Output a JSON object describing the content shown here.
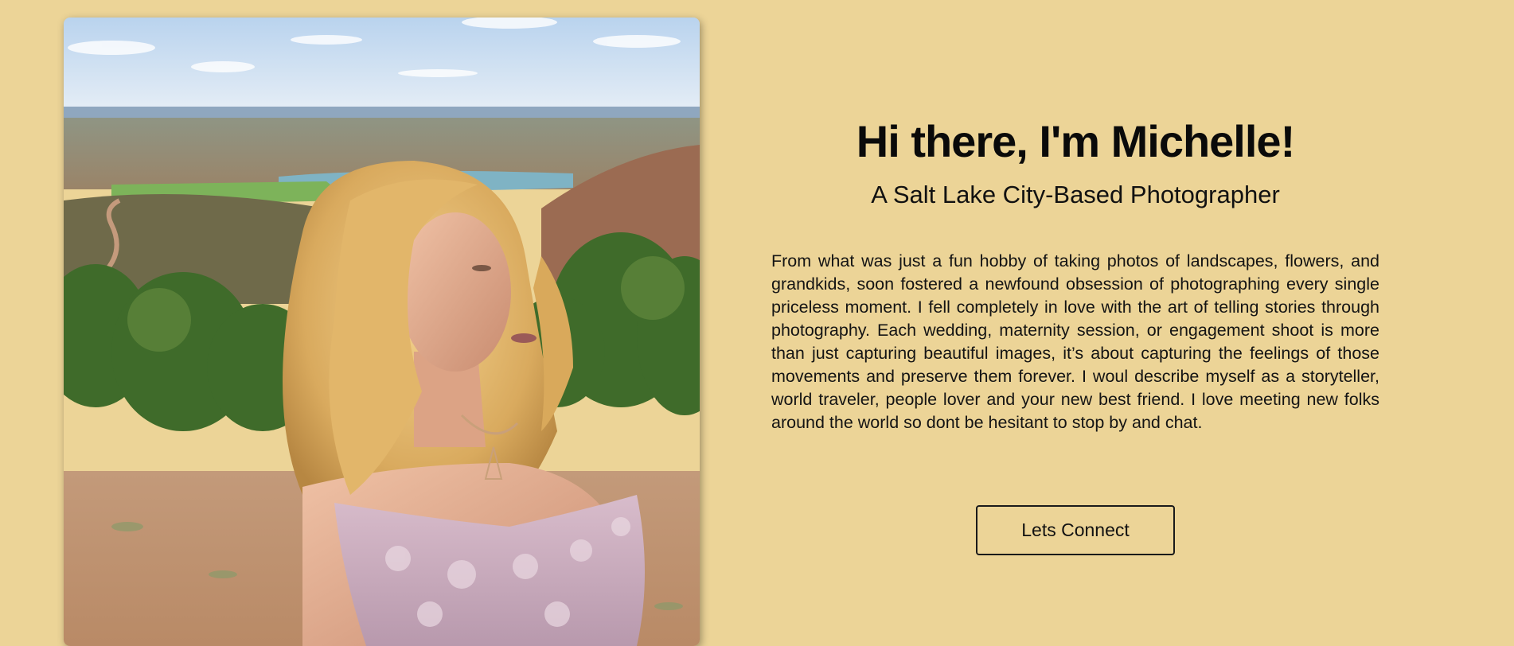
{
  "colors": {
    "page_background": "#ecd497",
    "text": "#111111",
    "button_border": "#1a1a1a"
  },
  "photo": {
    "alt": "Portrait of Michelle outdoors in front of a desert landscape"
  },
  "intro": {
    "headline": "Hi there, I'm Michelle!",
    "subheadline": "A Salt Lake City-Based Photographer",
    "bio": "From what was just a fun hobby of taking photos of landscapes, flowers, and grandkids, soon fostered a newfound obsession of photographing every single priceless moment. I fell completely in love with the art of telling stories through photography. Each wedding, maternity session, or engagement shoot is more than just capturing beautiful images, it’s about capturing the feelings of those movements and preserve them forever. I woul describe myself as a storyteller, world traveler, people lover and your new best friend. I love meeting new folks around the world so dont be hesitant to stop by and chat.",
    "cta_label": "Lets Connect"
  }
}
